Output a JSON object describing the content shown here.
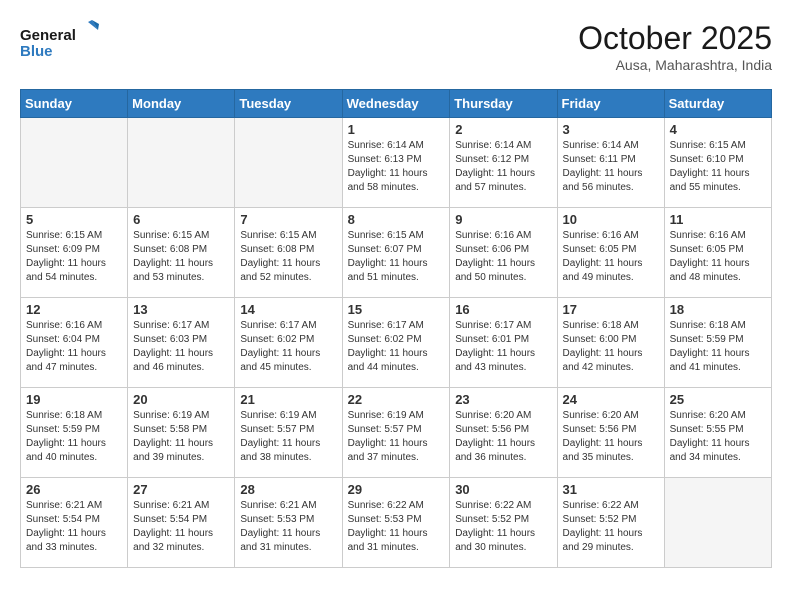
{
  "header": {
    "logo_line1": "General",
    "logo_line2": "Blue",
    "month": "October 2025",
    "location": "Ausa, Maharashtra, India"
  },
  "weekdays": [
    "Sunday",
    "Monday",
    "Tuesday",
    "Wednesday",
    "Thursday",
    "Friday",
    "Saturday"
  ],
  "weeks": [
    [
      {
        "day": "",
        "info": ""
      },
      {
        "day": "",
        "info": ""
      },
      {
        "day": "",
        "info": ""
      },
      {
        "day": "1",
        "info": "Sunrise: 6:14 AM\nSunset: 6:13 PM\nDaylight: 11 hours\nand 58 minutes."
      },
      {
        "day": "2",
        "info": "Sunrise: 6:14 AM\nSunset: 6:12 PM\nDaylight: 11 hours\nand 57 minutes."
      },
      {
        "day": "3",
        "info": "Sunrise: 6:14 AM\nSunset: 6:11 PM\nDaylight: 11 hours\nand 56 minutes."
      },
      {
        "day": "4",
        "info": "Sunrise: 6:15 AM\nSunset: 6:10 PM\nDaylight: 11 hours\nand 55 minutes."
      }
    ],
    [
      {
        "day": "5",
        "info": "Sunrise: 6:15 AM\nSunset: 6:09 PM\nDaylight: 11 hours\nand 54 minutes."
      },
      {
        "day": "6",
        "info": "Sunrise: 6:15 AM\nSunset: 6:08 PM\nDaylight: 11 hours\nand 53 minutes."
      },
      {
        "day": "7",
        "info": "Sunrise: 6:15 AM\nSunset: 6:08 PM\nDaylight: 11 hours\nand 52 minutes."
      },
      {
        "day": "8",
        "info": "Sunrise: 6:15 AM\nSunset: 6:07 PM\nDaylight: 11 hours\nand 51 minutes."
      },
      {
        "day": "9",
        "info": "Sunrise: 6:16 AM\nSunset: 6:06 PM\nDaylight: 11 hours\nand 50 minutes."
      },
      {
        "day": "10",
        "info": "Sunrise: 6:16 AM\nSunset: 6:05 PM\nDaylight: 11 hours\nand 49 minutes."
      },
      {
        "day": "11",
        "info": "Sunrise: 6:16 AM\nSunset: 6:05 PM\nDaylight: 11 hours\nand 48 minutes."
      }
    ],
    [
      {
        "day": "12",
        "info": "Sunrise: 6:16 AM\nSunset: 6:04 PM\nDaylight: 11 hours\nand 47 minutes."
      },
      {
        "day": "13",
        "info": "Sunrise: 6:17 AM\nSunset: 6:03 PM\nDaylight: 11 hours\nand 46 minutes."
      },
      {
        "day": "14",
        "info": "Sunrise: 6:17 AM\nSunset: 6:02 PM\nDaylight: 11 hours\nand 45 minutes."
      },
      {
        "day": "15",
        "info": "Sunrise: 6:17 AM\nSunset: 6:02 PM\nDaylight: 11 hours\nand 44 minutes."
      },
      {
        "day": "16",
        "info": "Sunrise: 6:17 AM\nSunset: 6:01 PM\nDaylight: 11 hours\nand 43 minutes."
      },
      {
        "day": "17",
        "info": "Sunrise: 6:18 AM\nSunset: 6:00 PM\nDaylight: 11 hours\nand 42 minutes."
      },
      {
        "day": "18",
        "info": "Sunrise: 6:18 AM\nSunset: 5:59 PM\nDaylight: 11 hours\nand 41 minutes."
      }
    ],
    [
      {
        "day": "19",
        "info": "Sunrise: 6:18 AM\nSunset: 5:59 PM\nDaylight: 11 hours\nand 40 minutes."
      },
      {
        "day": "20",
        "info": "Sunrise: 6:19 AM\nSunset: 5:58 PM\nDaylight: 11 hours\nand 39 minutes."
      },
      {
        "day": "21",
        "info": "Sunrise: 6:19 AM\nSunset: 5:57 PM\nDaylight: 11 hours\nand 38 minutes."
      },
      {
        "day": "22",
        "info": "Sunrise: 6:19 AM\nSunset: 5:57 PM\nDaylight: 11 hours\nand 37 minutes."
      },
      {
        "day": "23",
        "info": "Sunrise: 6:20 AM\nSunset: 5:56 PM\nDaylight: 11 hours\nand 36 minutes."
      },
      {
        "day": "24",
        "info": "Sunrise: 6:20 AM\nSunset: 5:56 PM\nDaylight: 11 hours\nand 35 minutes."
      },
      {
        "day": "25",
        "info": "Sunrise: 6:20 AM\nSunset: 5:55 PM\nDaylight: 11 hours\nand 34 minutes."
      }
    ],
    [
      {
        "day": "26",
        "info": "Sunrise: 6:21 AM\nSunset: 5:54 PM\nDaylight: 11 hours\nand 33 minutes."
      },
      {
        "day": "27",
        "info": "Sunrise: 6:21 AM\nSunset: 5:54 PM\nDaylight: 11 hours\nand 32 minutes."
      },
      {
        "day": "28",
        "info": "Sunrise: 6:21 AM\nSunset: 5:53 PM\nDaylight: 11 hours\nand 31 minutes."
      },
      {
        "day": "29",
        "info": "Sunrise: 6:22 AM\nSunset: 5:53 PM\nDaylight: 11 hours\nand 31 minutes."
      },
      {
        "day": "30",
        "info": "Sunrise: 6:22 AM\nSunset: 5:52 PM\nDaylight: 11 hours\nand 30 minutes."
      },
      {
        "day": "31",
        "info": "Sunrise: 6:22 AM\nSunset: 5:52 PM\nDaylight: 11 hours\nand 29 minutes."
      },
      {
        "day": "",
        "info": ""
      }
    ]
  ]
}
